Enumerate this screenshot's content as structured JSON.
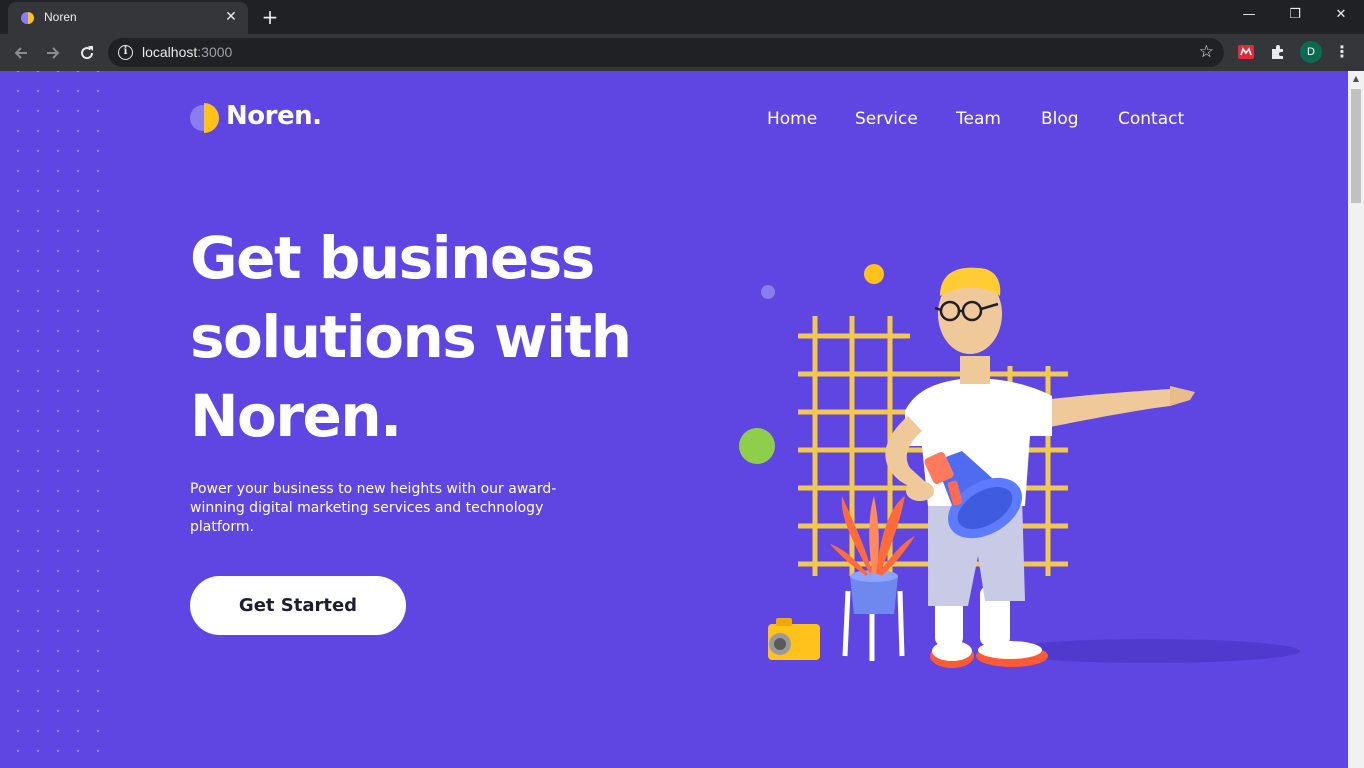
{
  "browser": {
    "tab_title": "Noren",
    "close_glyph": "✕",
    "new_tab_glyph": "+",
    "url_host": "localhost",
    "url_port": ":3000",
    "profile_initial": "D",
    "window_controls": {
      "minimize": "—",
      "restore": "❐",
      "close": "✕"
    }
  },
  "site": {
    "logo_text": "Noren.",
    "nav": [
      "Home",
      "Service",
      "Team",
      "Blog",
      "Contact"
    ],
    "hero": {
      "headline_lines": [
        "Get business",
        "solutions with",
        "Noren."
      ],
      "subtext": "Power your business to new heights with our award-winning digital marketing services and technology platform.",
      "cta_label": "Get Started"
    }
  },
  "colors": {
    "page_background": "#5f46e2",
    "logo_yellow": "#ffc21a",
    "logo_purple": "#8b7cf0",
    "accent_green": "#8fce4a",
    "grid_yellow": "#f2c94c"
  },
  "icons": {
    "back": "arrow-left-icon",
    "forward": "arrow-right-icon",
    "reload": "reload-icon",
    "info": "info-icon",
    "bookmark": "star-icon",
    "extensions": "puzzle-icon",
    "menu": "kebab-icon"
  }
}
